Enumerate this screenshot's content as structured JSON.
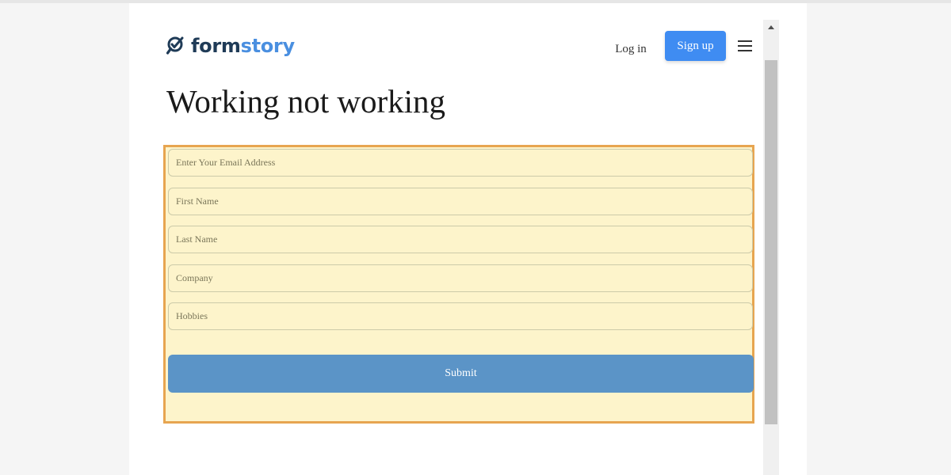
{
  "header": {
    "logo_text_dark": "form",
    "logo_text_accent": "story",
    "login_label": "Log in",
    "signup_label": "Sign up",
    "menu_icon": "hamburger-menu-icon",
    "logo_icon": "search-check-icon"
  },
  "page": {
    "title": "Working not working"
  },
  "form": {
    "fields": [
      {
        "placeholder": "Enter Your Email Address",
        "value": ""
      },
      {
        "placeholder": "First Name",
        "value": ""
      },
      {
        "placeholder": "Last Name",
        "value": ""
      },
      {
        "placeholder": "Company",
        "value": ""
      },
      {
        "placeholder": "Hobbies",
        "value": ""
      }
    ],
    "submit_label": "Submit"
  },
  "colors": {
    "brand_dark": "#1f3b57",
    "brand_accent": "#4a8fe0",
    "signup_button": "#3f8cf2",
    "form_background": "#fdf4cb",
    "form_border": "#e7a550",
    "submit_button": "#5b94c7"
  }
}
